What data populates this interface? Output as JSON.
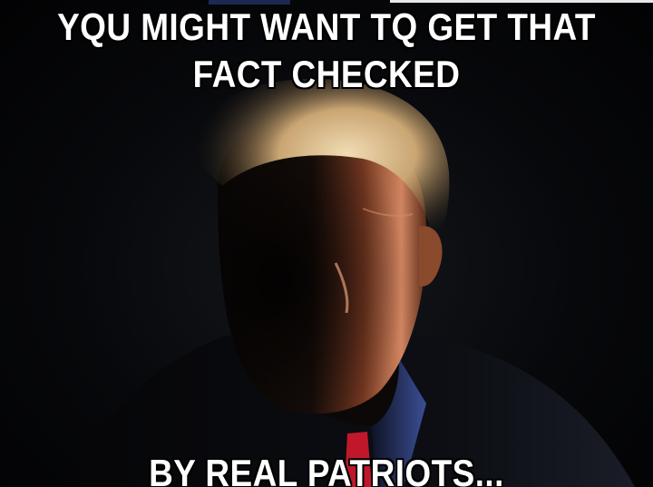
{
  "meme": {
    "top_text_line1": "YQU MIGHT WANT TQ GET THAT",
    "top_text_line2": "FACT CHECKED",
    "bottom_text": "BY REAL PATRIOTS..."
  },
  "colors": {
    "background": "#050608",
    "text": "#ffffff",
    "text_outline": "#000000",
    "hair_highlight": "#e2c79a",
    "skin_highlight": "#c9744e",
    "tie": "#c0182a",
    "shirt": "#3c4f96"
  }
}
